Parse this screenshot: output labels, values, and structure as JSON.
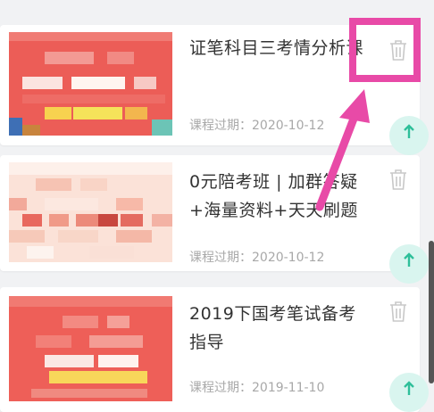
{
  "courses": [
    {
      "title": "证笔科目三考情分析课",
      "expire": "课程过期：2020-10-12",
      "thumb_icon": "pixelated-course-cover"
    },
    {
      "title": "0元陪考班 | 加群答疑+海量资料+天天刷题",
      "expire": "课程过期：2020-10-12",
      "thumb_icon": "pixelated-course-cover"
    },
    {
      "title": "2019下国考笔试备考指导",
      "expire": "课程过期：2019-11-10",
      "thumb_icon": "pixelated-course-cover"
    }
  ],
  "icons": {
    "delete": "trash-icon",
    "upgrade": "arrow-up-icon"
  },
  "colors": {
    "annotation": "#e84aa7",
    "badge": "#d9f5ef",
    "badge_arrow": "#2fbf9a"
  }
}
